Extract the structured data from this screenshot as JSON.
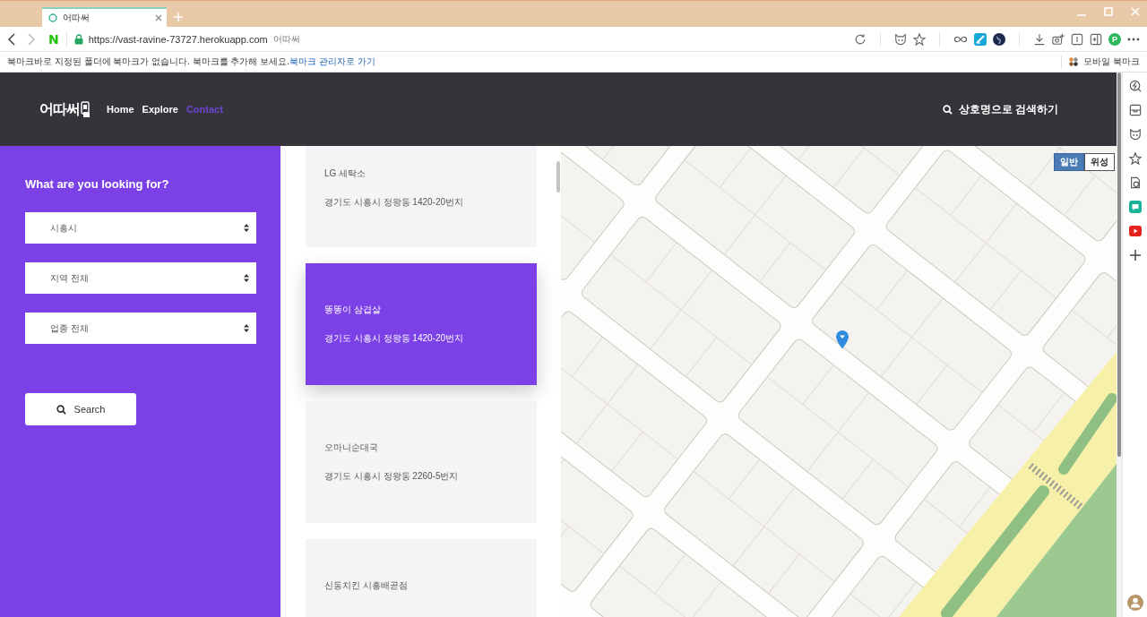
{
  "browser": {
    "tab": {
      "title": "어따써",
      "selected": true
    },
    "address_bar": {
      "start_button": "N",
      "url": "https://vast-ravine-73727.herokuapp.com",
      "page_title": "어따써",
      "profile_initial": "P"
    },
    "bookmark_bar": {
      "message": "북마크바로 지정된 폴더에 북마크가 없습니다. 북마크를 추가해 보세요.",
      "link": "북마크 관리자로 가기",
      "mobile_bookmarks": "모바일 북마크"
    }
  },
  "header": {
    "logo": "어따써",
    "nav": [
      {
        "label": "Home",
        "selected": false
      },
      {
        "label": "Explore",
        "selected": false
      },
      {
        "label": "Contact",
        "selected": true
      }
    ],
    "search_link": "상호명으로 검색하기"
  },
  "search_panel": {
    "heading": "What are you looking for?",
    "selects": [
      {
        "value": "시흥시"
      },
      {
        "value": "지역 전체"
      },
      {
        "value": "업종 전체"
      }
    ],
    "button": "Search"
  },
  "places": [
    {
      "name": "LG 세탁소",
      "address": "경기도 시흥시 정왕동 1420-20번지",
      "selected": false
    },
    {
      "name": "똥똥이 삼겹살",
      "address": "경기도 시흥시 정왕동 1420-20번지",
      "selected": true
    },
    {
      "name": "오마니순대국",
      "address": "경기도 시흥시 정왕동 2260-5번지",
      "selected": false
    },
    {
      "name": "신동치킨 시흥배곧점",
      "selected": false
    }
  ],
  "map": {
    "map_types": [
      {
        "label": "일반",
        "selected": true
      },
      {
        "label": "위성",
        "selected": false
      }
    ]
  }
}
